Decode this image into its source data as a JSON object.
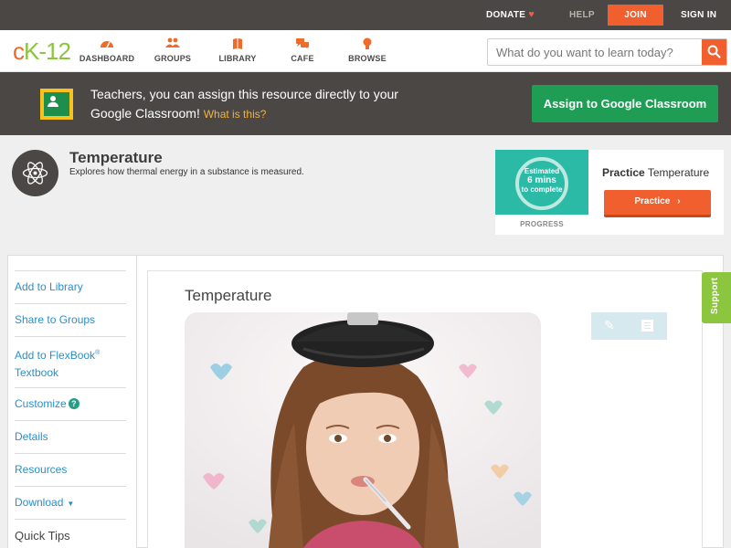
{
  "topbar": {
    "donate": "DONATE",
    "help": "HELP",
    "join": "JOIN",
    "signin": "SIGN IN"
  },
  "logo": {
    "c": "c",
    "k": "K",
    "n": "-12"
  },
  "nav": {
    "items": [
      {
        "label": "DASHBOARD",
        "icon": "dashboard-icon"
      },
      {
        "label": "GROUPS",
        "icon": "groups-icon"
      },
      {
        "label": "LIBRARY",
        "icon": "library-icon"
      },
      {
        "label": "CAFE",
        "icon": "cafe-icon"
      },
      {
        "label": "BROWSE",
        "icon": "browse-icon"
      }
    ],
    "search_placeholder": "What do you want to learn today?"
  },
  "banner": {
    "text": "Teachers, you can assign this resource directly to your Google Classroom!",
    "what_is_this": "What is this?",
    "button": "Assign to Google Classroom"
  },
  "concept": {
    "title": "Temperature",
    "description": "Explores how thermal energy in a substance is measured."
  },
  "practice": {
    "estimated": "Estimated",
    "mins": "6 mins",
    "to_complete": "to complete",
    "progress": "PROGRESS",
    "title_bold": "Practice",
    "title_rest": "Temperature",
    "button": "Practice"
  },
  "sidebar": {
    "items": [
      {
        "label": "Add to Library"
      },
      {
        "label": "Share to Groups"
      },
      {
        "label": "Add to FlexBook",
        "sup": "®",
        "line2": "Textbook"
      },
      {
        "label": "Customize"
      },
      {
        "label": "Details"
      },
      {
        "label": "Resources"
      },
      {
        "label": "Download"
      },
      {
        "label": "Quick Tips"
      }
    ]
  },
  "content": {
    "title": "Temperature"
  },
  "support": "Support",
  "colors": {
    "accent_orange": "#f15f2e",
    "brand_green": "#8cc63e",
    "google_green": "#1f9d55",
    "dark_bar": "#4b4744",
    "link_blue": "#2b8fc9"
  }
}
